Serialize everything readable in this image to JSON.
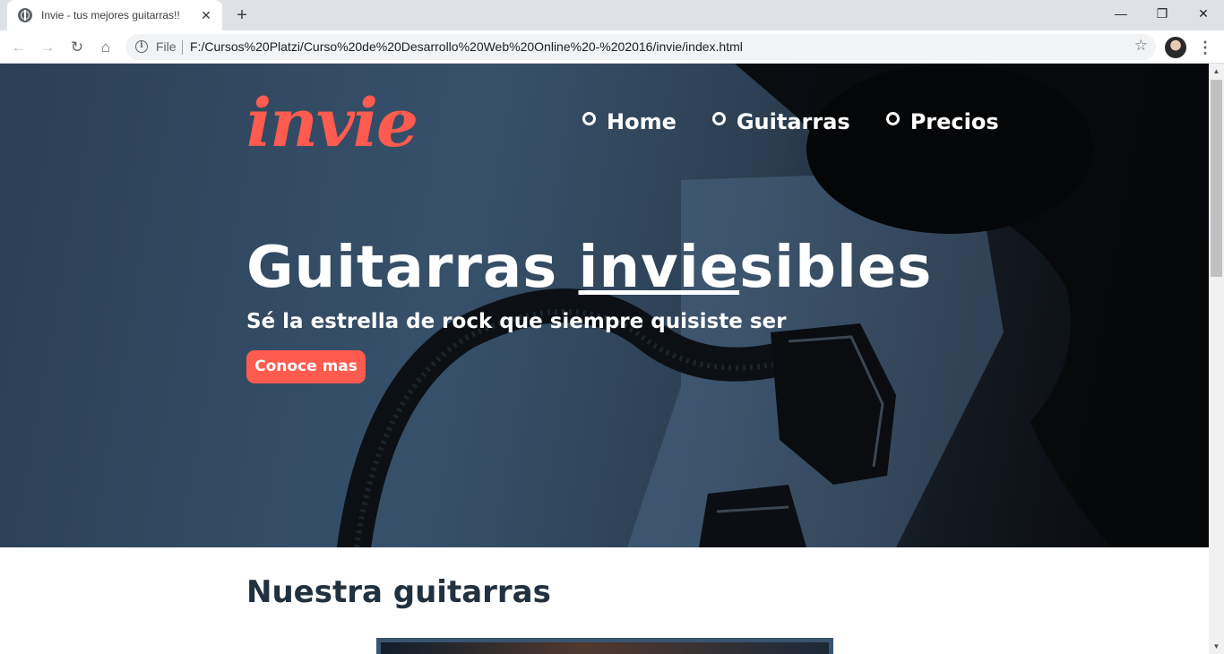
{
  "browser": {
    "tab_title": "Invie - tus mejores guitarras!!",
    "tab_close": "✕",
    "new_tab": "+",
    "window_controls": {
      "minimize": "—",
      "maximize": "❐",
      "close": "✕"
    },
    "nav": {
      "back": "←",
      "forward": "→",
      "reload": "↻",
      "home": "⌂"
    },
    "address": {
      "info": "i",
      "scheme": "File",
      "url": "F:/Cursos%20Platzi/Curso%20de%20Desarrollo%20Web%20Online%20-%202016/invie/index.html"
    },
    "bookmark": "☆",
    "menu": "⋮",
    "scroll_up": "▲",
    "scroll_down": "▼"
  },
  "page": {
    "logo": "invie",
    "menu": [
      {
        "label": "Home"
      },
      {
        "label": "Guitarras"
      },
      {
        "label": "Precios"
      }
    ],
    "hero": {
      "title_before": "Guitarras ",
      "title_underlined": "invie",
      "title_after": "sibles",
      "subtitle": "Sé la estrella de rock que siempre quisiste ser",
      "button": "Conoce mas"
    },
    "section_title": "Nuestra guitarras"
  },
  "colors": {
    "accent": "#ff5b4f",
    "hero_overlay": "#2b3f55",
    "heading": "#22313f"
  }
}
